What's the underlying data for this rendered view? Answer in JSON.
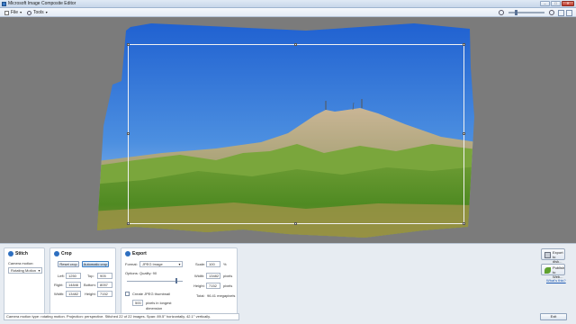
{
  "window": {
    "title": "Microsoft Image Composite Editor",
    "buttons": {
      "minimize": "–",
      "maximize": "□",
      "close": "✕"
    }
  },
  "menubar": {
    "file_label": "File",
    "tools_label": "Tools"
  },
  "toolbar": {
    "zoom_level_fraction": 0.2
  },
  "stitch": {
    "title": "Stitch",
    "number": "1",
    "camera_motion_label": "Camera motion:",
    "camera_motion_value": "Rotating Motion"
  },
  "crop": {
    "title": "Crop",
    "number": "2",
    "reset_crop": "Reset crop",
    "automatic_crop": "Automatic crop",
    "left_label": "Left:",
    "left_value": "1250",
    "top_label": "Top:",
    "top_value": "905",
    "right_label": "Right:",
    "right_value": "14846",
    "bottom_label": "Bottom:",
    "bottom_value": "8057",
    "width_label": "Width:",
    "width_value": "13482",
    "height_label": "Height:",
    "height_value": "7152"
  },
  "export": {
    "title": "Export",
    "number": "3",
    "format_label": "Format:",
    "format_value": "JPEG Image",
    "options_label": "Options: Quality: 90",
    "quality_fraction": 0.9,
    "thumbnail_label": "Create JPEG thumbnail",
    "thumbnail_size": "500",
    "thumbnail_suffix": "pixels in longest",
    "thumbnail_suffix2": "dimension",
    "scale_label": "Scale:",
    "scale_value": "100",
    "scale_unit": "%",
    "width_label": "Width:",
    "width_value": "13482",
    "width_unit": "pixels",
    "height_label": "Height:",
    "height_value": "7152",
    "height_unit": "pixels",
    "total_label": "Total:",
    "total_value": "96.41 megapixels"
  },
  "actions": {
    "export_disk": "Export to disk...",
    "publish_web": "Publish to Web...",
    "whats_this": "What's this?"
  },
  "status": {
    "text": "Camera motion type: rotating motion. Projection: perspective. Stitched 22 of 22 images. Span: 89.5° horizontally, 42.1° vertically."
  },
  "exit_label": "Exit"
}
